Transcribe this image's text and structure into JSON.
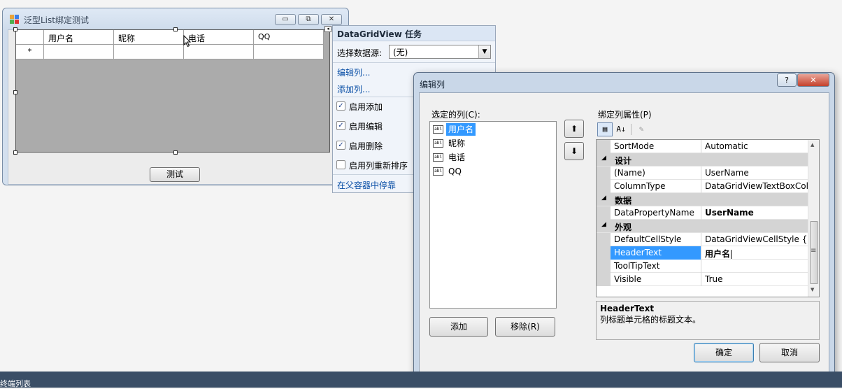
{
  "form": {
    "title": "泛型List绑定测试",
    "minimize_glyph": "▭",
    "maximize_glyph": "⧉",
    "close_glyph": "✕",
    "grid": {
      "columns": [
        "用户名",
        "昵称",
        "电话",
        "QQ"
      ],
      "new_row_marker": "*"
    },
    "test_button": "测试"
  },
  "tasks": {
    "title": "DataGridView 任务",
    "datasource_label": "选择数据源:",
    "datasource_value": "(无)",
    "edit_columns": "编辑列...",
    "add_column": "添加列...",
    "options": [
      {
        "label": "启用添加",
        "checked": true
      },
      {
        "label": "启用编辑",
        "checked": true
      },
      {
        "label": "启用删除",
        "checked": true
      },
      {
        "label": "启用列重新排序",
        "checked": false
      }
    ],
    "dock": "在父容器中停靠",
    "collapse_glyph": "◂"
  },
  "dialog": {
    "title": "编辑列",
    "help_glyph": "?",
    "close_glyph": "✕",
    "selected_label": "选定的列(C):",
    "columns": [
      {
        "label": "用户名",
        "icon": "abl",
        "selected": true
      },
      {
        "label": "昵称",
        "icon": "abl"
      },
      {
        "label": "电话",
        "icon": "abl"
      },
      {
        "label": "QQ",
        "icon": "abl"
      }
    ],
    "move_up": "⬆",
    "move_down": "⬇",
    "add_button": "添加",
    "remove_button": "移除(R)",
    "props_label": "绑定列属性(P)",
    "toolbar": {
      "categorized": "▤",
      "alpha": "A↓",
      "pages": "✎"
    },
    "properties": [
      {
        "name": "SortMode",
        "value": "Automatic"
      },
      {
        "category": "设计"
      },
      {
        "name": "(Name)",
        "value": "UserName"
      },
      {
        "name": "ColumnType",
        "value": "DataGridViewTextBoxColumn"
      },
      {
        "category": "数据"
      },
      {
        "name": "DataPropertyName",
        "value": "UserName",
        "bold": true
      },
      {
        "category": "外观"
      },
      {
        "name": "DefaultCellStyle",
        "value": "DataGridViewCellStyle { }"
      },
      {
        "name": "HeaderText",
        "value": "用户名",
        "bold": true,
        "selected": true
      },
      {
        "name": "ToolTipText",
        "value": ""
      },
      {
        "name": "Visible",
        "value": "True"
      }
    ],
    "category_glyph": "◢",
    "scroll_up": "▲",
    "scroll_down": "▼",
    "scroll_grip": "≡",
    "help_title": "HeaderText",
    "help_text": "列标题单元格的标题文本。",
    "ok_button": "确定",
    "cancel_button": "取消"
  },
  "status": {
    "text": "终端列表"
  }
}
